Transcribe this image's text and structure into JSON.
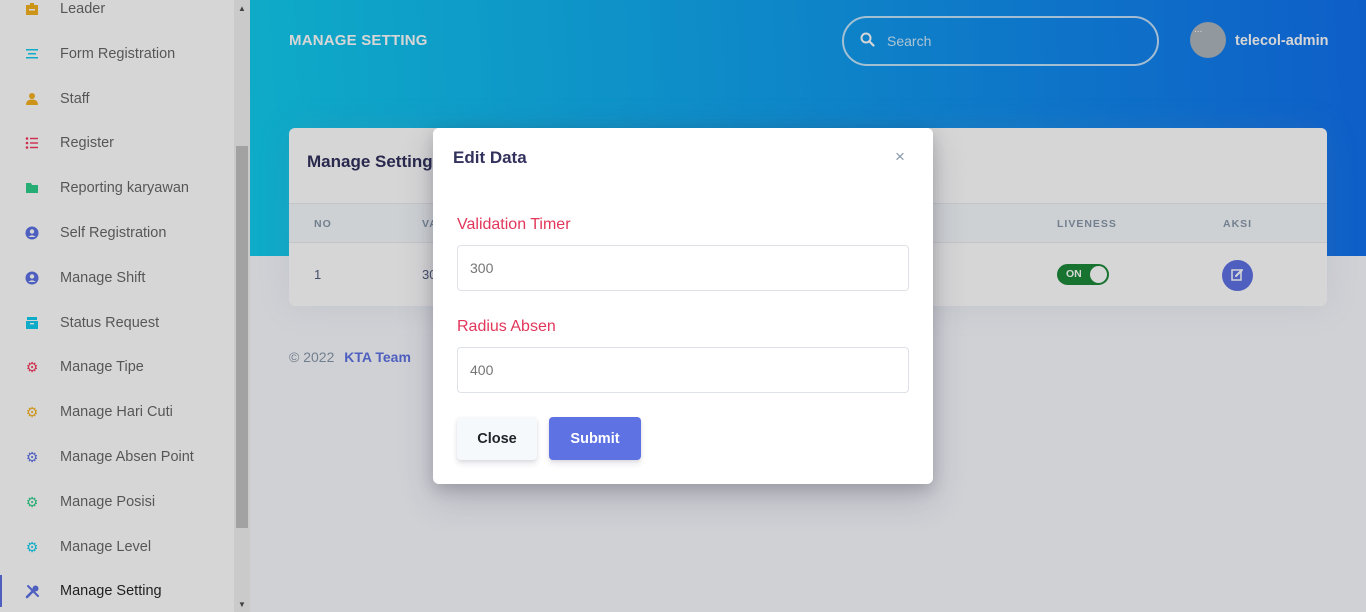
{
  "sidebar": {
    "items": [
      {
        "label": "Leader",
        "icon": "badge-icon",
        "color": "#f5b120"
      },
      {
        "label": "Form Registration",
        "icon": "list-icon",
        "color": "#11cdef"
      },
      {
        "label": "Staff",
        "icon": "user-icon",
        "color": "#f5b120"
      },
      {
        "label": "Register",
        "icon": "bullet-list-icon",
        "color": "#f5365c"
      },
      {
        "label": "Reporting karyawan",
        "icon": "folder-icon",
        "color": "#2dce89"
      },
      {
        "label": "Self Registration",
        "icon": "user-circle-icon",
        "color": "#5e72e4"
      },
      {
        "label": "Manage Shift",
        "icon": "user-circle-icon",
        "color": "#5e72e4"
      },
      {
        "label": "Status Request",
        "icon": "archive-icon",
        "color": "#11cdef"
      },
      {
        "label": "Manage Tipe",
        "icon": "gear-icon",
        "color": "#f5365c"
      },
      {
        "label": "Manage Hari Cuti",
        "icon": "gear-icon",
        "color": "#f5b120"
      },
      {
        "label": "Manage Absen Point",
        "icon": "gear-icon",
        "color": "#5e72e4"
      },
      {
        "label": "Manage Posisi",
        "icon": "gear-icon",
        "color": "#2dce89"
      },
      {
        "label": "Manage Level",
        "icon": "gear-icon",
        "color": "#11cdef"
      },
      {
        "label": "Manage Setting",
        "icon": "tools-icon",
        "color": "#5e72e4"
      }
    ]
  },
  "header": {
    "title": "MANAGE SETTING",
    "search_placeholder": "Search",
    "avatar_alt": "...",
    "username": "telecol-admin"
  },
  "card": {
    "title": "Manage Setting",
    "columns": [
      "NO",
      "VA",
      "LIVENESS",
      "AKSI"
    ],
    "row": {
      "no": "1",
      "value": "30",
      "liveness": "ON"
    }
  },
  "footer": {
    "copyright": "© 2022",
    "team": "KTA Team"
  },
  "modal": {
    "title": "Edit Data",
    "close_glyph": "×",
    "fields": [
      {
        "label": "Validation Timer",
        "placeholder": "300"
      },
      {
        "label": "Radius Absen",
        "placeholder": "400"
      }
    ],
    "close_label": "Close",
    "submit_label": "Submit"
  }
}
